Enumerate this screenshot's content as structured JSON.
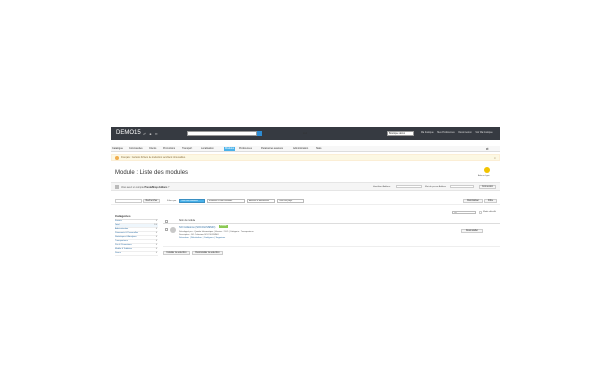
{
  "header": {
    "shop_name": "DEMO15",
    "icons": [
      "cart-icon",
      "user-icon",
      "comment-icon"
    ],
    "search": {
      "placeholder": "",
      "scope": "tout"
    },
    "shop_select": "Boutique démo",
    "links": [
      "Ma boutique",
      "Mes Préférences",
      "Déconnexion",
      "Voir Ma boutique"
    ]
  },
  "menu": {
    "items": [
      {
        "label": "Catalogue",
        "icon": "book-icon"
      },
      {
        "label": "Commandes",
        "icon": "cart-icon"
      },
      {
        "label": "Clients",
        "icon": "user-icon"
      },
      {
        "label": "Promotions",
        "icon": "tag-icon"
      },
      {
        "label": "Transport",
        "icon": "truck-icon"
      },
      {
        "label": "Localisation",
        "icon": "globe-icon"
      },
      {
        "label": "Modules",
        "icon": "puzzle-icon",
        "active": true
      },
      {
        "label": "Préférences",
        "icon": "wrench-icon"
      },
      {
        "label": "Paramètres avancés",
        "icon": "gear-icon"
      },
      {
        "label": "Administration",
        "icon": "key-icon"
      },
      {
        "label": "Stats",
        "icon": "chart-icon"
      }
    ]
  },
  "alert": {
    "text": "Français : Certains fichiers de traduction semblent introuvables."
  },
  "page": {
    "title": "Module : Liste des modules",
    "help_label": "Aide en ligne"
  },
  "connect": {
    "text_prefix": "Vous avez un compte",
    "text_link": "PrestaShop Addons",
    "text_suffix": "?",
    "login_label": "Identifiant Addons",
    "password_label": "Mot de passe Addons",
    "button": "Connexion"
  },
  "filters": {
    "search_button": "Rechercher",
    "filter_label": "Filtrer par",
    "type_value": "Tous les modules",
    "installed_value": "Installés et non installés",
    "status_value": "Activés & désactivés",
    "country_value": "Tous les pays",
    "reset_button": "Réinitialiser",
    "filter_button": "Filtre"
  },
  "sort": {
    "select_value": "Tri",
    "check_label": "Mode détaillé"
  },
  "categories": {
    "title": "Catégories",
    "items": [
      {
        "label": "Favoris",
        "count": "0"
      },
      {
        "label": "Total",
        "count": "1/0"
      },
      {
        "label": "Administration",
        "count": "0"
      },
      {
        "label": "Paiements & Passerelles",
        "count": "0"
      },
      {
        "label": "Statistiques & Analyses",
        "count": "0"
      },
      {
        "label": "Transporteurs",
        "count": "0"
      },
      {
        "label": "Prix & Promotions",
        "count": "0"
      },
      {
        "label": "Mobile & Tablettes",
        "count": "0"
      },
      {
        "label": "Divers",
        "count": "0"
      }
    ]
  },
  "list": {
    "header_label": "Nom du module",
    "modules": [
      {
        "name": "SO Colissimo (SOCOLISSIMO)",
        "badge": "Installé",
        "meta": "Développé par : Quadra Informatique | Version : 2.8.5 | Catégorie : Transporteurs",
        "description": "Description : SO Colissimo SOCOLISSIMO",
        "links": [
          "Désactiver",
          "Réinitialiser",
          "Configurer",
          "Supprimer"
        ],
        "action_button": "Désinstaller"
      }
    ]
  },
  "bulk": {
    "install_button": "Installer la sélection",
    "uninstall_button": "Désinstaller la sélection"
  }
}
